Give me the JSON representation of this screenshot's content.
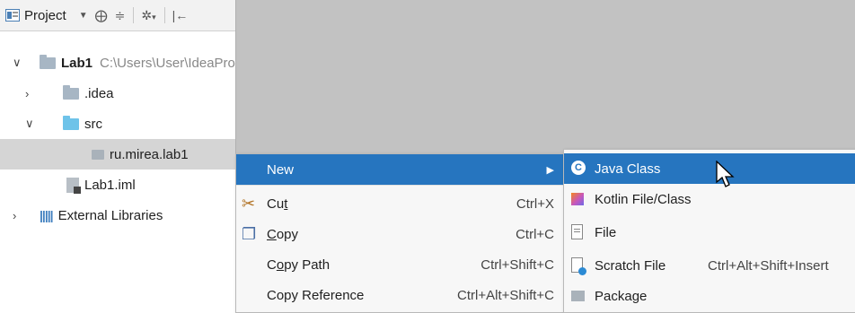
{
  "toolbar": {
    "title": "Project",
    "icons": [
      "project-view-icon",
      "dropdown-icon",
      "locate-icon",
      "collapse-icon",
      "gear-icon",
      "hide-icon"
    ]
  },
  "tree": {
    "root_name": "Lab1",
    "root_path": "C:\\Users\\User\\IdeaPro",
    "idea": ".idea",
    "src": "src",
    "package": "ru.mirea.lab1",
    "iml": "Lab1.iml",
    "external": "External Libraries"
  },
  "context_menu": {
    "new": "New",
    "cut_pre": "Cu",
    "cut_u": "t",
    "cut_short": "Ctrl+X",
    "copy_pre": "",
    "copy_u": "C",
    "copy_post": "opy",
    "copy_short": "Ctrl+C",
    "copypath_pre": "C",
    "copypath_u": "o",
    "copypath_post": "py Path",
    "copypath_short": "Ctrl+Shift+C",
    "copyref": "Copy Reference",
    "copyref_short": "Ctrl+Alt+Shift+C"
  },
  "new_submenu": {
    "java_class": "Java Class",
    "kotlin": "Kotlin File/Class",
    "file": "File",
    "scratch": "Scratch File",
    "scratch_short": "Ctrl+Alt+Shift+Insert",
    "package": "Package"
  },
  "colors": {
    "highlight": "#2675bf",
    "editor_bg": "#c2c2c2",
    "selection": "#d5d5d5"
  }
}
